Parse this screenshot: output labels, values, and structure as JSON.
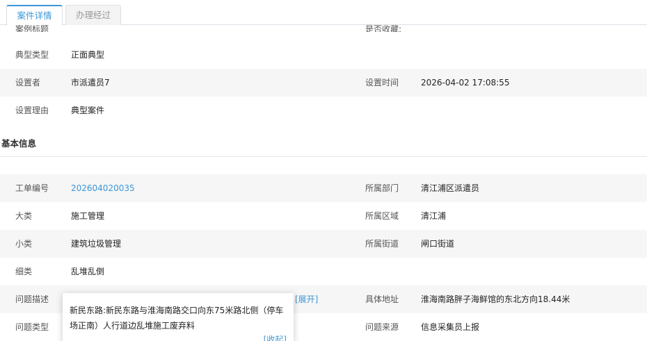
{
  "tabs": [
    {
      "label": "案件详情"
    },
    {
      "label": "办理经过"
    }
  ],
  "top_clipped": {
    "label_left": "案例标题",
    "label_right": "是否收藏:"
  },
  "typical": [
    {
      "label": "典型类型",
      "value": "正面典型"
    },
    {
      "label": "设置者",
      "value": "市派遣员7",
      "label2": "设置时间",
      "value2": "2026-04-02 17:08:55"
    },
    {
      "label": "设置理由",
      "value": "典型案件"
    }
  ],
  "section": {
    "title": "基本信息"
  },
  "basic": [
    {
      "label": "工单编号",
      "value": "202604020035",
      "label2": "所属部门",
      "value2": "清江浦区派遣员"
    },
    {
      "label": "大类",
      "value": "施工管理",
      "label2": "所属区域",
      "value2": "清江浦"
    },
    {
      "label": "小类",
      "value": "建筑垃圾管理",
      "label2": "所属街道",
      "value2": "闸口街道"
    },
    {
      "label": "细类",
      "value": "乱堆乱倒"
    },
    {
      "label": "问题描述",
      "expand": "[展开]",
      "label2": "具体地址",
      "value2": "淮海南路胖子海鲜馆的东北方向18.44米"
    },
    {
      "label": "问题类型",
      "label2": "问题来源",
      "value2": "信息采集员上报"
    }
  ],
  "popup": {
    "text": "新民东路:新民东路与淮海南路交口向东75米路北侧（停车场正南）人行道边乱堆施工废弃料",
    "collapse": "[收起]"
  }
}
